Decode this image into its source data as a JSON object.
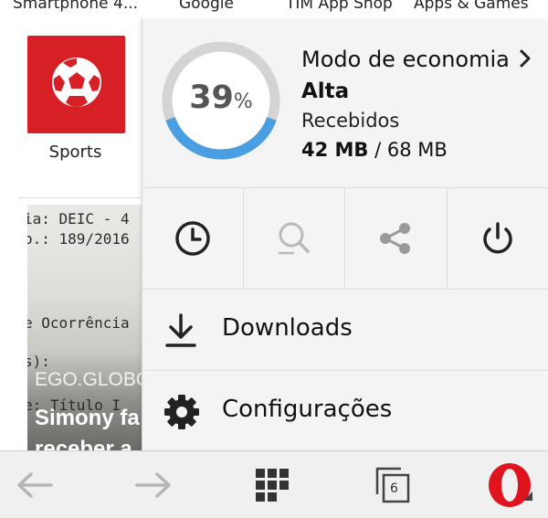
{
  "speed_dial": {
    "top_labels": [
      "Smartphone 4...",
      "Google",
      "TIM App Shop",
      "Apps & Games"
    ],
    "tile_label": "Sports"
  },
  "news": {
    "doc_lines": [
      "ia: DEIC - 4",
      "o.: 189/2016",
      "e Ocorrência",
      "s):",
      "e: Título I"
    ],
    "source": "EGO.GLOBO",
    "headline_line1": "Simony fa",
    "headline_line2": "receber a"
  },
  "menu": {
    "saving": {
      "percent_value": "39",
      "percent_sign": "%",
      "percent_fraction": 0.39,
      "title": "Modo de economia",
      "level": "Alta",
      "received_label": "Recebidos",
      "received_used": "42 MB",
      "received_separator": " / ",
      "received_total": "68 MB"
    },
    "icon_row": [
      "history-icon",
      "search-icon",
      "share-icon",
      "power-icon"
    ],
    "items": [
      {
        "label": "Downloads",
        "icon": "download-icon"
      },
      {
        "label": "Configurações",
        "icon": "gear-icon"
      }
    ]
  },
  "toolbar": {
    "tab_count": "6",
    "buttons": [
      "back-icon",
      "forward-icon",
      "speed-dial-icon",
      "tabs-icon",
      "opera-menu-icon"
    ]
  },
  "colors": {
    "ring_fill": "#4a9ee2",
    "ring_track": "#d4d4d4",
    "sports_red": "#d71f26",
    "opera_red": "#e0141f"
  }
}
